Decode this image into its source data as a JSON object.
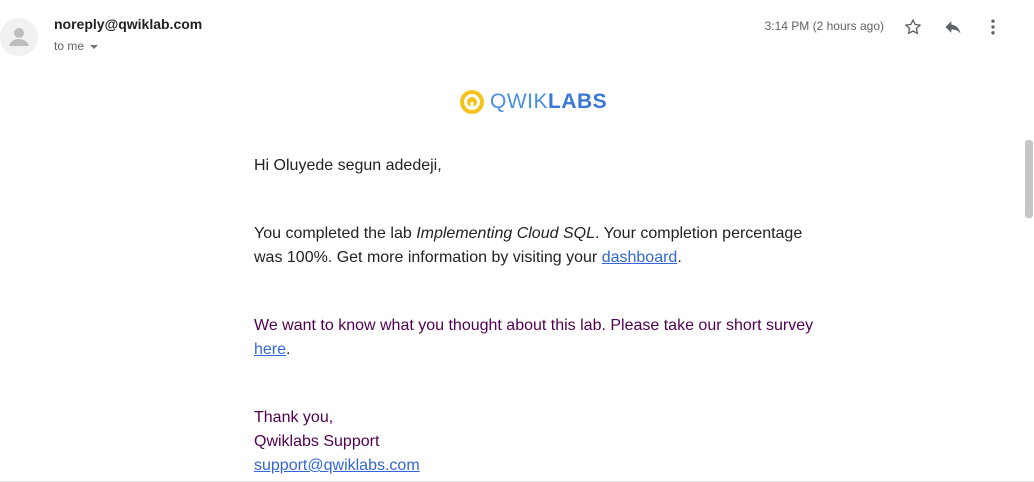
{
  "header": {
    "sender": "noreply@qwiklab.com",
    "recipient": "to me",
    "timestamp": "3:14 PM (2 hours ago)",
    "icons": {
      "avatar": "person-icon",
      "star": "star-outline-icon",
      "reply": "reply-icon",
      "more": "more-vert-icon"
    }
  },
  "logo": {
    "prefix": "QWIK",
    "suffix": "LABS",
    "accent": "#f6c21c",
    "brand": "#3a77d6"
  },
  "email": {
    "greeting": "Hi Oluyede segun adedeji,",
    "p1_a": "You completed the lab ",
    "lab_name": "Implementing Cloud SQL",
    "p1_b": ". Your completion percentage was 100%. Get more information by visiting your ",
    "dashboard_link": "dashboard",
    "p1_c": ".",
    "p2_a": "We want to know what you thought about this lab. Please take our short survey ",
    "here_link": "here",
    "p2_b": ".",
    "signoff": "Thank you,",
    "team": "Qwiklabs Support",
    "support_email": "support@qwiklabs.com"
  },
  "colors": {
    "link": "#3367d6",
    "quoted_text": "#500050"
  }
}
